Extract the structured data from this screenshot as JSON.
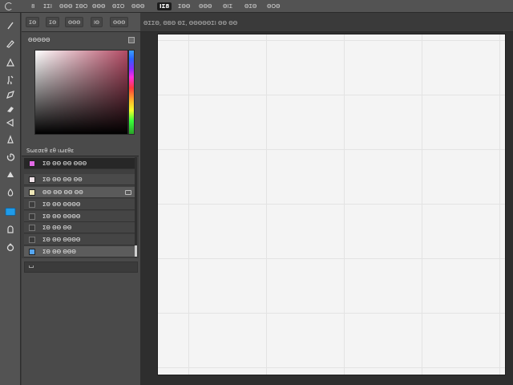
{
  "menubar": {
    "items": [
      {
        "label": "8"
      },
      {
        "label": "ΣΣΙ"
      },
      {
        "label": "ΘΘΘ"
      },
      {
        "label": "ΣΘΟ"
      },
      {
        "label": "ΘΘΘ"
      },
      {
        "label": "ΘΣΟ"
      },
      {
        "label": "ΘΘΘ"
      },
      {
        "label": "ΙΣ8"
      },
      {
        "label": "ΣΘΘ"
      },
      {
        "label": "ΘΘΘ"
      },
      {
        "label": "ΘΙΣ"
      },
      {
        "label": "ΘΣΘ"
      },
      {
        "label": "ΘΟΘ"
      }
    ],
    "active_index": 7
  },
  "options_bar": {
    "buttons": [
      {
        "label": "ΣΘ"
      },
      {
        "label": "ΣΘ"
      },
      {
        "label": "ΘΘΘ"
      },
      {
        "label": "ΙΘ"
      },
      {
        "label": "ΘΘΘ"
      }
    ]
  },
  "document": {
    "tab_label": "ΘΣΣΘ, ΘΒΘ ΘΣ, ΘΘΘΘΘΣΙ ΘΘ ΘΘ"
  },
  "color_panel": {
    "title": "ΘΘΘΘΘ"
  },
  "list_panel": {
    "title": "Sωεσεθ εθ ιωεθε",
    "rows": [
      {
        "label": "ΣΘ ΘΘ ΘΘ ΘΘΘ",
        "color": "#e26ae6"
      },
      {
        "label": "ΣΘ ΘΘ ΘΘ ΘΘ",
        "color": "#f0e2e8"
      },
      {
        "label": "ΘΘ ΘΘ ΘΘ ΘΘ",
        "color": "#efe7b8"
      },
      {
        "label": "ΣΘ ΘΘ ΘΘΘΘ",
        "color": "#3c3c3c"
      },
      {
        "label": "ΣΘ ΘΘ ΘΘΘΘ",
        "color": "#3a3a3a"
      },
      {
        "label": "ΣΘ ΘΘ ΘΘ",
        "color": "#3a3a3a"
      },
      {
        "label": "ΣΘ ΘΘ ΘΘΘΘ",
        "color": "#3a3a3a"
      },
      {
        "label": "ΣΘ ΘΘ ΘΘΘ",
        "color": "#56a6f2"
      }
    ],
    "selected_index": 0
  },
  "colors": {
    "accent": "#1f9be8",
    "canvas": "#f4f4f4"
  },
  "tools": [
    {
      "name": "move-tool-icon"
    },
    {
      "name": "brush-tool-icon"
    },
    {
      "name": "fill-tool-icon"
    },
    {
      "name": "smudge-tool-icon"
    },
    {
      "name": "pen-tool-icon"
    },
    {
      "name": "eraser-tool-icon"
    },
    {
      "name": "clone-tool-icon"
    },
    {
      "name": "drop-tool-icon"
    },
    {
      "name": "dodge-tool-icon"
    },
    {
      "name": "blur-tool-icon"
    },
    {
      "name": "shape-tool-icon"
    },
    {
      "name": "rectangle-tool-icon"
    },
    {
      "name": "lock-tool-icon"
    },
    {
      "name": "lasso-tool-icon"
    }
  ]
}
